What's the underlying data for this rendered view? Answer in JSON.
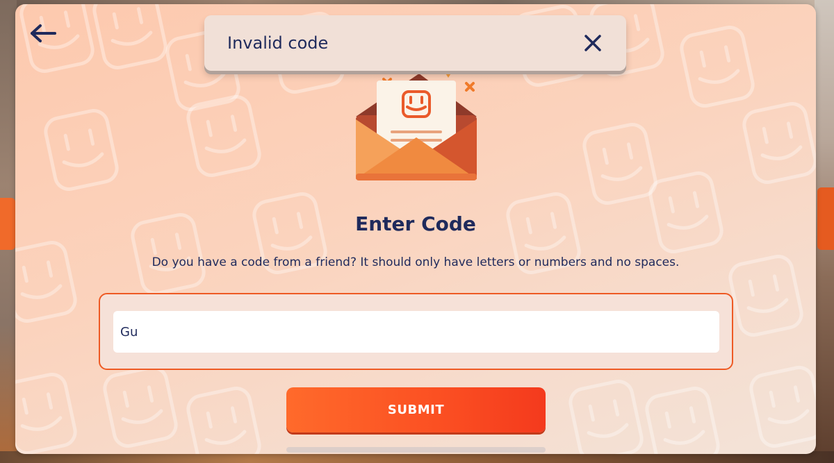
{
  "nav": {
    "back_icon": "arrow-left-icon"
  },
  "toast": {
    "message": "Invalid code",
    "close_icon": "close-icon"
  },
  "hero": {
    "icon": "envelope-with-card-icon"
  },
  "main": {
    "title": "Enter Code",
    "description": "Do you have a code from a friend? It should only have letters or numbers and no spaces.",
    "code_input": {
      "value": "Gu",
      "placeholder": ""
    },
    "submit_label": "SUBMIT"
  },
  "colors": {
    "accent": "#ee5a24",
    "text": "#1f2a5c",
    "panel_bg": "#fbd3bd",
    "toast_bg": "#f1e0d7"
  }
}
